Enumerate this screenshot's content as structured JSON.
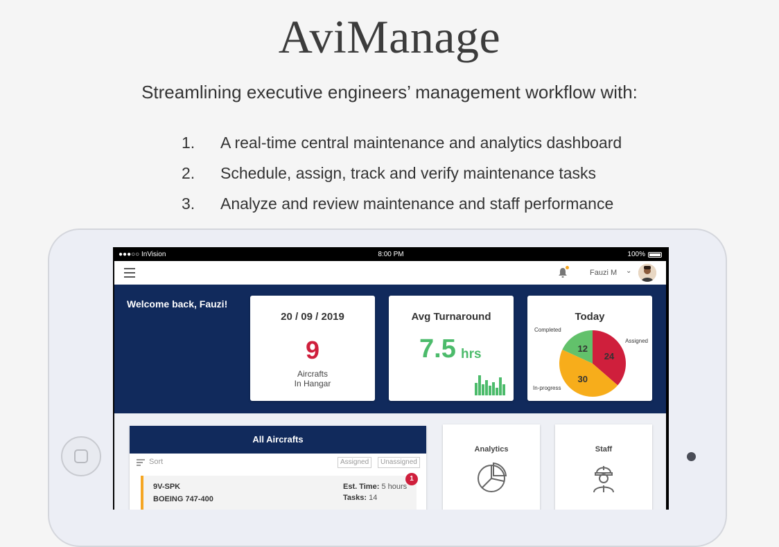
{
  "page": {
    "title": "AviManage",
    "subtitle": "Streamlining executive engineers’ management workflow with:",
    "features": [
      {
        "num": "1.",
        "text": "A real-time central maintenance and analytics dashboard"
      },
      {
        "num": "2.",
        "text": "Schedule, assign, track and verify maintenance tasks"
      },
      {
        "num": "3.",
        "text": "Analyze and review maintenance and staff performance"
      }
    ]
  },
  "status_bar": {
    "carrier": "●●●○○ InVision",
    "time": "8:00 PM",
    "battery": "100%"
  },
  "app_bar": {
    "user_name": "Fauzi M",
    "chevron": "⌄",
    "menu_icon": "hamburger-icon",
    "bell_icon": "bell-icon"
  },
  "dashboard": {
    "welcome": "Welcome back, Fauzi!",
    "date_card": {
      "date": "20 / 09 / 2019",
      "count": "9",
      "label_line1": "Aircrafts",
      "label_line2": "In Hangar"
    },
    "avg_card": {
      "title": "Avg Turnaround",
      "value": "7.5",
      "unit": "hrs",
      "mini_bars": [
        0.55,
        0.9,
        0.5,
        0.7,
        0.45,
        0.6,
        0.35,
        0.8,
        0.5
      ]
    },
    "today_card": {
      "title": "Today"
    }
  },
  "chart_data": {
    "type": "pie",
    "title": "Today",
    "slices": [
      {
        "label": "Completed",
        "value": 12,
        "color": "#62c16b"
      },
      {
        "label": "Assigned",
        "value": 24,
        "color": "#cf1f3c"
      },
      {
        "label": "In-progress",
        "value": 30,
        "color": "#f7ad1b"
      }
    ]
  },
  "aircraft_panel": {
    "title": "All Aircrafts",
    "sort_label": "Sort",
    "filters": [
      "Assigned",
      "Unassigned"
    ],
    "rows": [
      {
        "reg": "9V-SPK",
        "model": "BOEING 747-400",
        "est_time_label": "Est. Time:",
        "est_time": "5 hours",
        "tasks_label": "Tasks:",
        "tasks": "14",
        "badge": "1"
      }
    ]
  },
  "tiles": {
    "analytics": {
      "label": "Analytics",
      "icon": "pie-chart-icon"
    },
    "staff": {
      "label": "Staff",
      "icon": "engineer-icon"
    }
  },
  "colors": {
    "navy": "#112a5c",
    "red": "#cf1f3c",
    "green": "#4cbb6b",
    "orange": "#f5a623"
  }
}
